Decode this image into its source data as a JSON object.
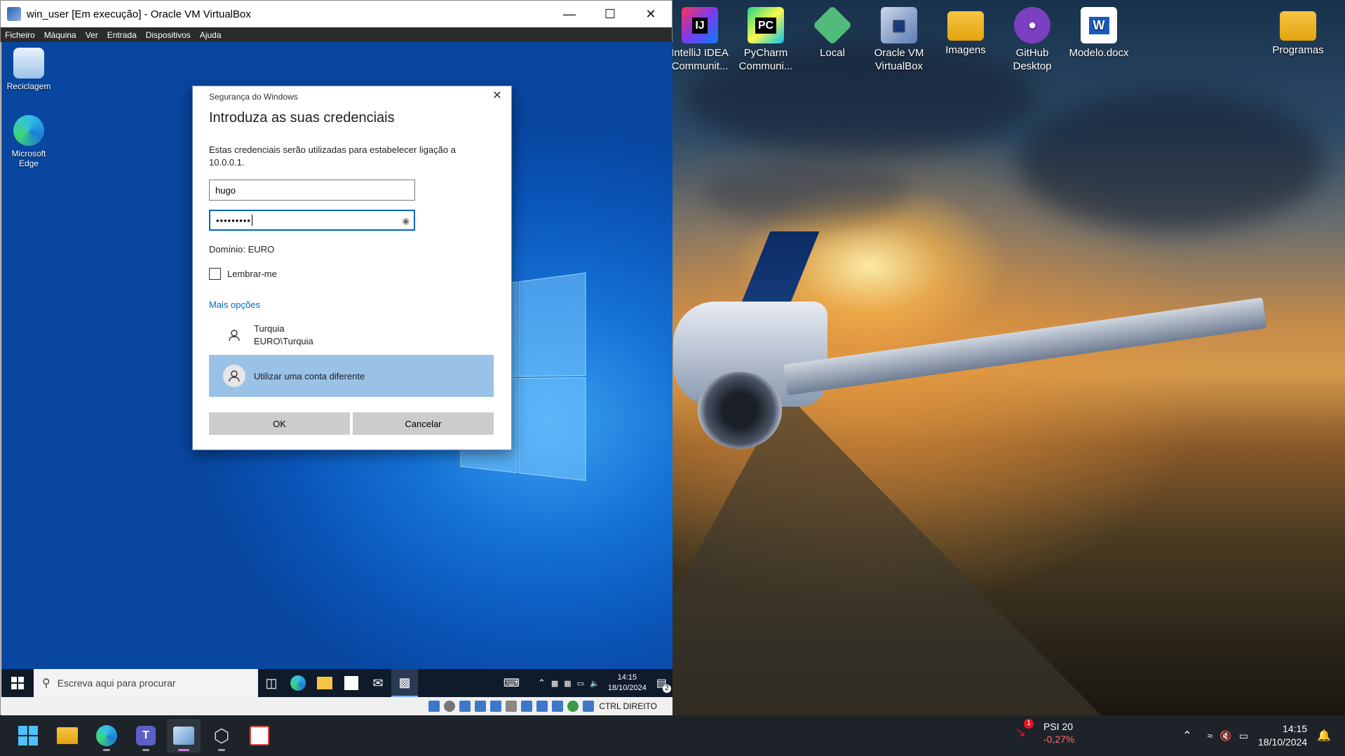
{
  "host_desktop": {
    "icons": [
      {
        "label": "IntelliJ IDEA Communit...",
        "icon": "intellij-icon"
      },
      {
        "label": "PyCharm Communi...",
        "icon": "pycharm-icon"
      },
      {
        "label": "Local",
        "icon": "local-icon"
      },
      {
        "label": "Oracle VM VirtualBox",
        "icon": "virtualbox-icon"
      },
      {
        "label": "Imagens",
        "icon": "folder-icon"
      },
      {
        "label": "GitHub Desktop",
        "icon": "github-icon"
      },
      {
        "label": "Modelo.docx",
        "icon": "word-icon"
      },
      {
        "label": "Programas",
        "icon": "folder-icon"
      }
    ]
  },
  "vbox": {
    "title": "win_user [Em execução] - Oracle VM VirtualBox",
    "menu": [
      "Ficheiro",
      "Máquina",
      "Ver",
      "Entrada",
      "Dispositivos",
      "Ajuda"
    ],
    "status_host_key": "CTRL DIREITO"
  },
  "guest_desktop": {
    "icons": [
      {
        "label": "Reciclagem",
        "icon": "recycle-bin-icon"
      },
      {
        "label": "Microsoft Edge",
        "icon": "edge-icon"
      }
    ]
  },
  "dialog": {
    "window_title": "Segurança do Windows",
    "heading": "Introduza as suas credenciais",
    "description": "Estas credenciais serão utilizadas para estabelecer ligação a 10.0.0.1.",
    "username": "hugo",
    "password_mask": "•••••••••",
    "domain": "Domínio: EURO",
    "remember_label": "Lembrar-me",
    "remember_checked": false,
    "more_options": "Mais opções",
    "accounts": [
      {
        "name": "Turquia",
        "detail": "EURO\\Turquia"
      },
      {
        "name": "Utilizar uma conta diferente",
        "selected": true
      }
    ],
    "ok_label": "OK",
    "cancel_label": "Cancelar"
  },
  "guest_taskbar": {
    "search_placeholder": "Escreva aqui para procurar",
    "time": "14:15",
    "date": "18/10/2024",
    "notifications": "2"
  },
  "host_taskbar": {
    "stock_name": "PSI 20",
    "stock_change": "-0,27%",
    "stock_badge": "1",
    "time": "14:15",
    "date": "18/10/2024"
  },
  "colors": {
    "accent": "#0067c0",
    "selected_account": "#99c2e6",
    "negative": "#ff6b6b"
  }
}
